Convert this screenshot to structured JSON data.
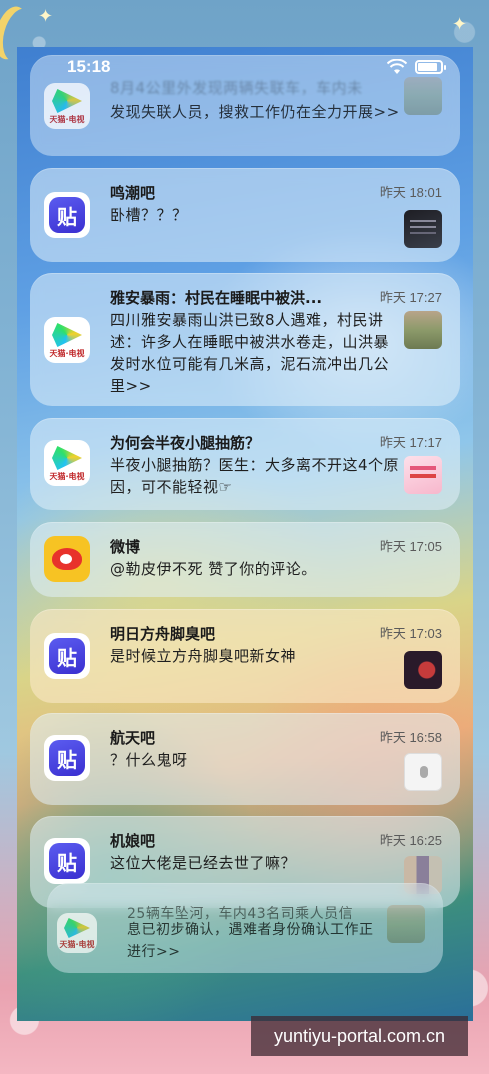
{
  "status_bar": {
    "time": "15:18"
  },
  "notifications": [
    {
      "app": "video-app",
      "title": "",
      "partial_text": "8月4公里外发现两辆失联车，车内未",
      "body": "发现失联人员，搜救工作仍在全力开展>>",
      "time": "",
      "thumb": "landscape-thumb"
    },
    {
      "app": "tieba",
      "title": "鸣潮吧",
      "body": "卧槽？？？",
      "time": "昨天 18:01",
      "thumb": "dark-thumb"
    },
    {
      "app": "video-app",
      "title": "雅安暴雨：村民在睡眠中被洪...",
      "body": "四川雅安暴雨山洪已致8人遇难，村民讲述：许多人在睡眠中被洪水卷走，山洪暴发时水位可能有几米高，泥石流冲出几公里>>",
      "time": "昨天 17:27",
      "thumb": "landscape-thumb"
    },
    {
      "app": "video-app",
      "title": "为何会半夜小腿抽筋？",
      "body": "半夜小腿抽筋？医生：大多离不开这4个原因，可不能轻视☞",
      "time": "昨天 17:17",
      "thumb": "pink-thumb"
    },
    {
      "app": "weibo",
      "title": "微博",
      "body": "@勒皮伊不死 赞了你的评论。",
      "time": "昨天 17:05",
      "thumb": ""
    },
    {
      "app": "tieba",
      "title": "明日方舟脚臭吧",
      "body": "是时候立方舟脚臭吧新女神",
      "time": "昨天 17:03",
      "thumb": "game-thumb"
    },
    {
      "app": "tieba",
      "title": "航天吧",
      "body": "？什么鬼呀",
      "time": "昨天 16:58",
      "thumb": "white-thumb"
    },
    {
      "app": "tieba",
      "title": "机娘吧",
      "body": "这位大佬是已经去世了嘛？",
      "time": "昨天 16:25",
      "thumb": "photo-thumb"
    },
    {
      "app": "video-app",
      "title": "",
      "partial_text": "25辆车坠河，车内43名司乘人员信",
      "body": "息已初步确认，遇难者身份确认工作正进行>>",
      "time": "",
      "thumb": "landscape-thumb"
    }
  ],
  "icons": {
    "tieba_glyph": "贴",
    "video_caption": "天猫·电视"
  },
  "watermark": "yuntiyu-portal.com.cn",
  "colors": {
    "tieba": "#4b43e0",
    "weibo_bg": "#f7c323",
    "weibo_red": "#e8322b"
  }
}
